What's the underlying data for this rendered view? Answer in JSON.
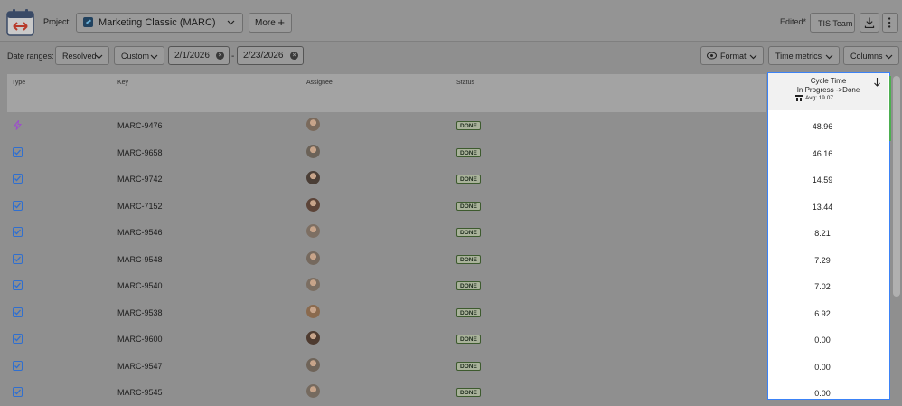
{
  "header": {
    "project_label": "Project:",
    "project_name": "Marketing Classic (MARC)",
    "more_label": "More",
    "edited_label": "Edited*",
    "team_label": "TIS Team"
  },
  "toolbar": {
    "date_ranges_label": "Date ranges:",
    "resolved_label": "Resolved",
    "custom_label": "Custom",
    "start_date": "2/1/2026",
    "end_date": "2/23/2026",
    "separator": "-",
    "format_label": "Format",
    "time_metrics_label": "Time metrics",
    "columns_label": "Columns"
  },
  "table": {
    "columns": {
      "type": "Type",
      "key": "Key",
      "assignee": "Assignee",
      "status": "Status"
    },
    "cycle_time": {
      "title": "Cycle Time",
      "subtitle": "In Progress ->Done",
      "avg": "Avg: 19.07"
    },
    "rows": [
      {
        "type": "epic",
        "key": "MARC-9476",
        "status": "DONE",
        "cycle": "48.96"
      },
      {
        "type": "task",
        "key": "MARC-9658",
        "status": "DONE",
        "cycle": "46.16"
      },
      {
        "type": "task",
        "key": "MARC-9742",
        "status": "DONE",
        "cycle": "14.59"
      },
      {
        "type": "task",
        "key": "MARC-7152",
        "status": "DONE",
        "cycle": "13.44"
      },
      {
        "type": "task",
        "key": "MARC-9546",
        "status": "DONE",
        "cycle": "8.21"
      },
      {
        "type": "task",
        "key": "MARC-9548",
        "status": "DONE",
        "cycle": "7.29"
      },
      {
        "type": "task",
        "key": "MARC-9540",
        "status": "DONE",
        "cycle": "7.02"
      },
      {
        "type": "task",
        "key": "MARC-9538",
        "status": "DONE",
        "cycle": "6.92"
      },
      {
        "type": "task",
        "key": "MARC-9600",
        "status": "DONE",
        "cycle": "0.00"
      },
      {
        "type": "task",
        "key": "MARC-9547",
        "status": "DONE",
        "cycle": "0.00"
      },
      {
        "type": "task",
        "key": "MARC-9545",
        "status": "DONE",
        "cycle": "0.00"
      }
    ]
  },
  "colors": {
    "accent": "#3b82f6",
    "done_border": "#3d5a2e",
    "epic": "#9c4dcc",
    "task": "#2f6fd0"
  }
}
